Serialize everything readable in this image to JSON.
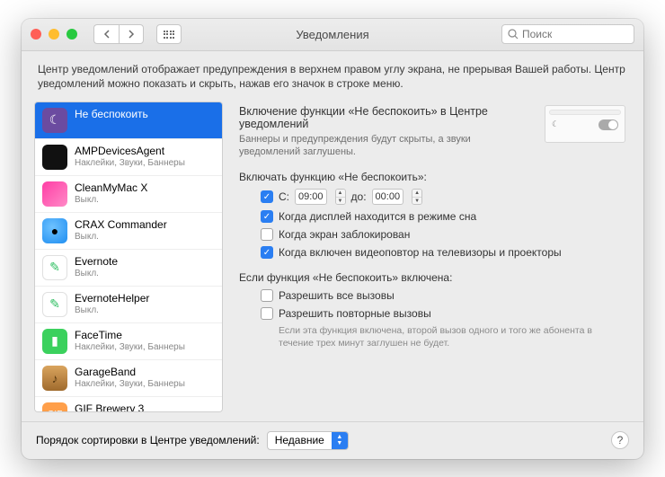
{
  "window": {
    "title": "Уведомления",
    "search_placeholder": "Поиск"
  },
  "intro": "Центр уведомлений отображает предупреждения в верхнем правом углу экрана, не прерывая Вашей работы. Центр уведомлений можно показать и скрыть, нажав его значок в строке меню.",
  "sidebar": {
    "items": [
      {
        "name": "Не беспокоить",
        "sub": "",
        "icon": "moon",
        "color": "#6b4ba0"
      },
      {
        "name": "AMPDevicesAgent",
        "sub": "Наклейки, Звуки, Баннеры",
        "icon": "black",
        "color": "#111"
      },
      {
        "name": "CleanMyMac X",
        "sub": "Выкл.",
        "icon": "cmm",
        "color": "#ff3ea5"
      },
      {
        "name": "CRAX Commander",
        "sub": "Выкл.",
        "icon": "disk",
        "color": "#1f8ef1"
      },
      {
        "name": "Evernote",
        "sub": "Выкл.",
        "icon": "evernote",
        "color": "#2dbe60"
      },
      {
        "name": "EvernoteHelper",
        "sub": "Выкл.",
        "icon": "evernote",
        "color": "#2dbe60"
      },
      {
        "name": "FaceTime",
        "sub": "Наклейки, Звуки, Баннеры",
        "icon": "facetime",
        "color": "#3bd15d"
      },
      {
        "name": "GarageBand",
        "sub": "Наклейки, Звуки, Баннеры",
        "icon": "gb",
        "color": "#c48a3b"
      },
      {
        "name": "GIF Brewery 3",
        "sub": "",
        "icon": "gif",
        "color": "#ff9f4a"
      }
    ]
  },
  "detail": {
    "title": "Включение функции «Не беспокоить» в Центре уведомлений",
    "subtitle": "Баннеры и предупреждения будут скрыты, а звуки уведомлений заглушены.",
    "section_schedule": "Включать функцию «Не беспокоить»:",
    "schedule": {
      "from_label": "С:",
      "from_value": "09:00",
      "to_label": "до:",
      "to_value": "00:00"
    },
    "opt_sleep": "Когда дисплей находится в режиме сна",
    "opt_locked": "Когда экран заблокирован",
    "opt_mirror": "Когда включен видеоповтор на телевизоры и проекторы",
    "section_calls": "Если функция «Не беспокоить» включена:",
    "opt_all_calls": "Разрешить все вызовы",
    "opt_repeat_calls": "Разрешить повторные вызовы",
    "repeat_desc": "Если эта функция включена, второй вызов одного и того же абонента в течение трех минут заглушен не будет."
  },
  "footer": {
    "label": "Порядок сортировки в Центре уведомлений:",
    "select_value": "Недавние"
  }
}
